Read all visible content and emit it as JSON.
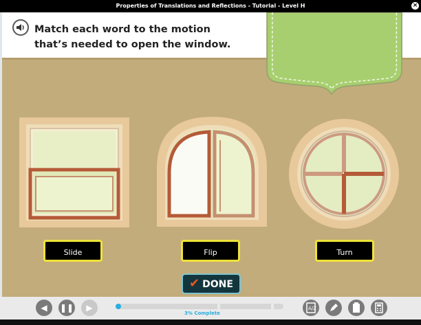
{
  "window": {
    "title": "Properties of Translations and Reflections - Tutorial - Level H"
  },
  "instruction": {
    "line1": "Match each word to the motion",
    "line2": "that’s needed to open the window."
  },
  "words": [
    {
      "label": "Slide"
    },
    {
      "label": "Flip"
    },
    {
      "label": "Turn"
    }
  ],
  "done_label": "DONE",
  "progress": {
    "text": "3% Complete",
    "percent": 3
  },
  "nav": {
    "back_icon": "arrow-left-icon",
    "pause_icon": "pause-icon",
    "forward_icon": "arrow-right-icon"
  },
  "tools": {
    "glossary_icon": "glossary-icon",
    "pencil_icon": "pencil-icon",
    "notepad_icon": "notepad-icon",
    "calculator_icon": "calculator-icon"
  },
  "colors": {
    "background": "#c3ac7b",
    "button_border": "#efe33a",
    "window_frame": "#b55a37",
    "progress_text": "#28aee0"
  }
}
